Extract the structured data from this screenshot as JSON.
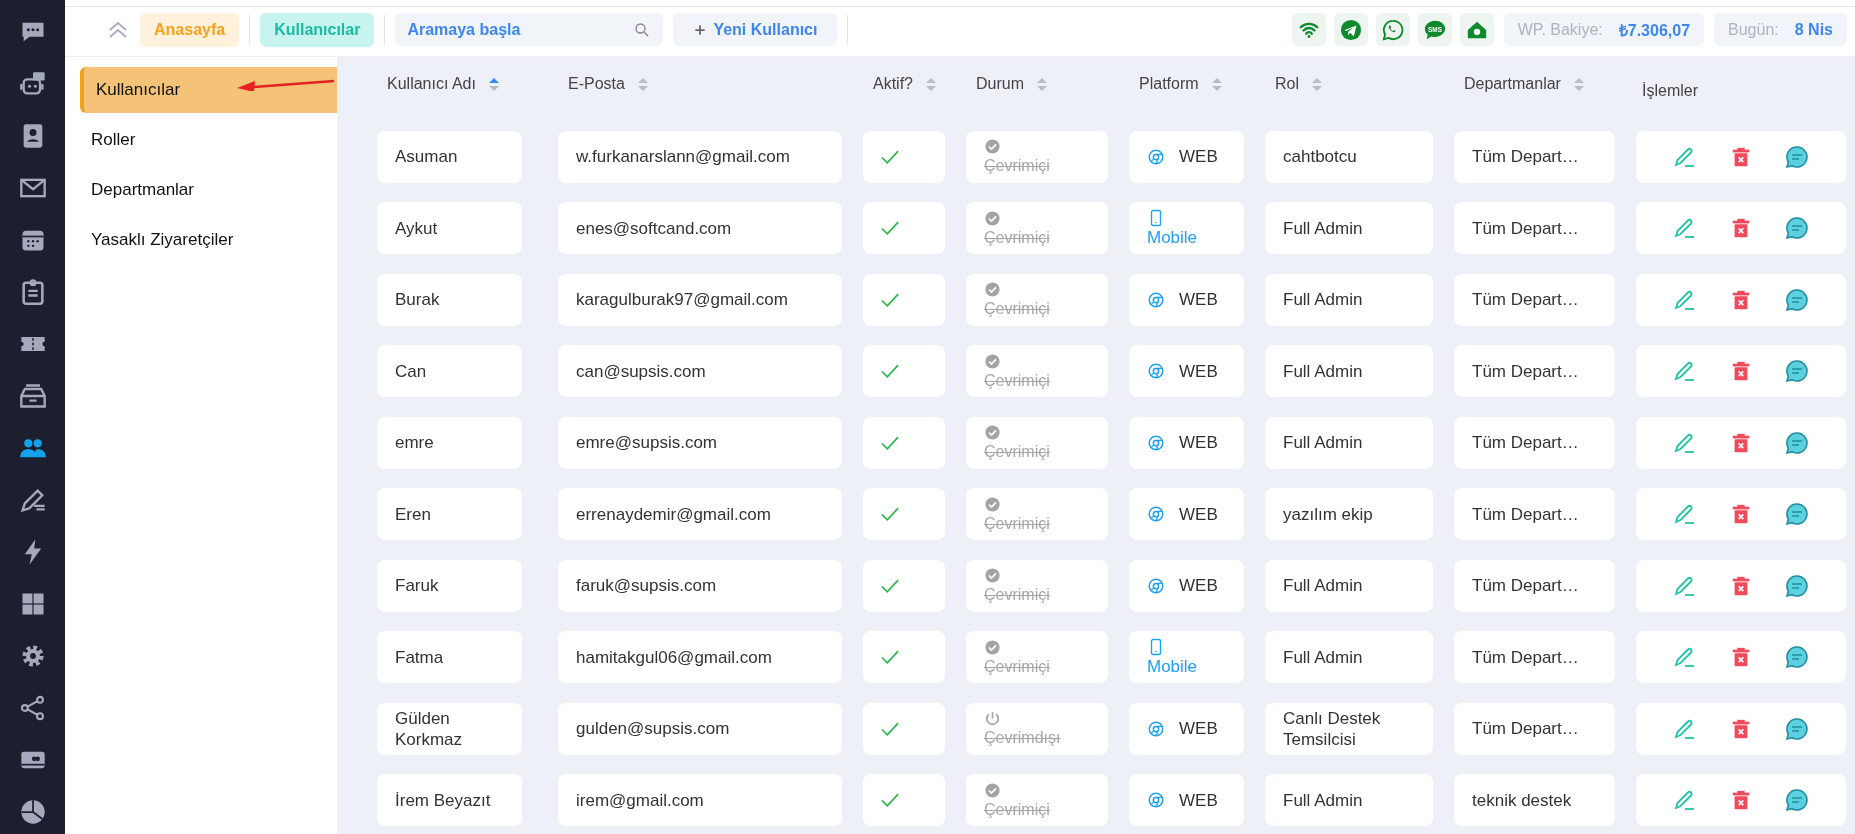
{
  "rail": [
    {
      "kind": "chat",
      "selected": false
    },
    {
      "kind": "bot",
      "selected": false
    },
    {
      "kind": "contacts",
      "selected": false
    },
    {
      "kind": "mail",
      "selected": false
    },
    {
      "kind": "calendar",
      "selected": false
    },
    {
      "kind": "clipboard",
      "selected": false
    },
    {
      "kind": "ticket",
      "selected": false
    },
    {
      "kind": "archive",
      "selected": false
    },
    {
      "kind": "users",
      "selected": true
    },
    {
      "kind": "edit",
      "selected": false
    },
    {
      "kind": "bolt",
      "selected": false
    },
    {
      "kind": "grid",
      "selected": false
    },
    {
      "kind": "settings",
      "selected": false
    },
    {
      "kind": "share",
      "selected": false
    },
    {
      "kind": "card",
      "selected": false
    },
    {
      "kind": "pie",
      "selected": false
    }
  ],
  "topbar": {
    "breadcrumbs": [
      {
        "label": "Anasayfa",
        "kind": "home"
      },
      {
        "label": "Kullanıcılar",
        "kind": "current"
      }
    ],
    "search": {
      "placeholder": "Aramaya başla"
    },
    "new_button": "Yeni Kullanıcı",
    "channels": [
      {
        "kind": "wifi"
      },
      {
        "kind": "telegram"
      },
      {
        "kind": "whatsapp"
      },
      {
        "kind": "sms",
        "text": "SMS"
      },
      {
        "kind": "home"
      }
    ],
    "balance": {
      "label": "WP. Bakiye:",
      "value": "₺7.306,07"
    },
    "today": {
      "label": "Bugün:",
      "value": "8 Nis"
    }
  },
  "submenu": [
    {
      "label": "Kullanıcılar",
      "selected": true
    },
    {
      "label": "Roller",
      "selected": false
    },
    {
      "label": "Departmanlar",
      "selected": false
    },
    {
      "label": "Yasaklı Ziyaretçiler",
      "selected": false
    }
  ],
  "table": {
    "columns": [
      {
        "label": "Kullanıcı Adı",
        "sortable": true,
        "sorted": true
      },
      {
        "label": "E-Posta",
        "sortable": true,
        "sorted": false
      },
      {
        "label": "Aktif?",
        "sortable": true,
        "sorted": false
      },
      {
        "label": "Durum",
        "sortable": true,
        "sorted": false
      },
      {
        "label": "Platform",
        "sortable": true,
        "sorted": false
      },
      {
        "label": "Rol",
        "sortable": true,
        "sorted": false
      },
      {
        "label": "Departmanlar",
        "sortable": true,
        "sorted": false
      },
      {
        "label": "İşlemler"
      }
    ],
    "rows": [
      {
        "name": "Asuman",
        "email": "w.furkanarslann@gmail.com",
        "active": true,
        "status": {
          "kind": "online",
          "label": "Çevrimiçi"
        },
        "platform": {
          "kind": "web",
          "label": "WEB"
        },
        "role": "cahtbotcu",
        "departments": "Tüm Depart…"
      },
      {
        "name": "Aykut",
        "email": "enes@softcand.com",
        "active": true,
        "status": {
          "kind": "online",
          "label": "Çevrimiçi"
        },
        "platform": {
          "kind": "mobile",
          "label": "Mobile"
        },
        "role": "Full Admin",
        "departments": "Tüm Depart…"
      },
      {
        "name": "Burak",
        "email": "karagulburak97@gmail.com",
        "active": true,
        "status": {
          "kind": "online",
          "label": "Çevrimiçi"
        },
        "platform": {
          "kind": "web",
          "label": "WEB"
        },
        "role": "Full Admin",
        "departments": "Tüm Depart…"
      },
      {
        "name": "Can",
        "email": "can@supsis.com",
        "active": true,
        "status": {
          "kind": "online",
          "label": "Çevrimiçi"
        },
        "platform": {
          "kind": "web",
          "label": "WEB"
        },
        "role": "Full Admin",
        "departments": "Tüm Depart…"
      },
      {
        "name": "emre",
        "email": "emre@supsis.com",
        "active": true,
        "status": {
          "kind": "online",
          "label": "Çevrimiçi"
        },
        "platform": {
          "kind": "web",
          "label": "WEB"
        },
        "role": "Full Admin",
        "departments": "Tüm Depart…"
      },
      {
        "name": "Eren",
        "email": "errenaydemir@gmail.com",
        "active": true,
        "status": {
          "kind": "online",
          "label": "Çevrimiçi"
        },
        "platform": {
          "kind": "web",
          "label": "WEB"
        },
        "role": "yazılım ekip",
        "departments": "Tüm Depart…"
      },
      {
        "name": "Faruk",
        "email": "faruk@supsis.com",
        "active": true,
        "status": {
          "kind": "online",
          "label": "Çevrimiçi"
        },
        "platform": {
          "kind": "web",
          "label": "WEB"
        },
        "role": "Full Admin",
        "departments": "Tüm Depart…"
      },
      {
        "name": "Fatma",
        "email": "hamitakgul06@gmail.com",
        "active": true,
        "status": {
          "kind": "online",
          "label": "Çevrimiçi"
        },
        "platform": {
          "kind": "mobile",
          "label": "Mobile"
        },
        "role": "Full Admin",
        "departments": "Tüm Depart…"
      },
      {
        "name": "Gülden Korkmaz",
        "email": "gulden@supsis.com",
        "active": true,
        "status": {
          "kind": "offline",
          "label": "Çevrimdışı"
        },
        "platform": {
          "kind": "web",
          "label": "WEB"
        },
        "role": "Canlı Destek Temsilcisi",
        "departments": "Tüm Depart…"
      },
      {
        "name": "İrem Beyazıt",
        "email": "irem@gmail.com",
        "active": true,
        "status": {
          "kind": "online",
          "label": "Çevrimiçi"
        },
        "platform": {
          "kind": "web",
          "label": "WEB"
        },
        "role": "Full Admin",
        "departments": "teknik destek"
      }
    ]
  }
}
